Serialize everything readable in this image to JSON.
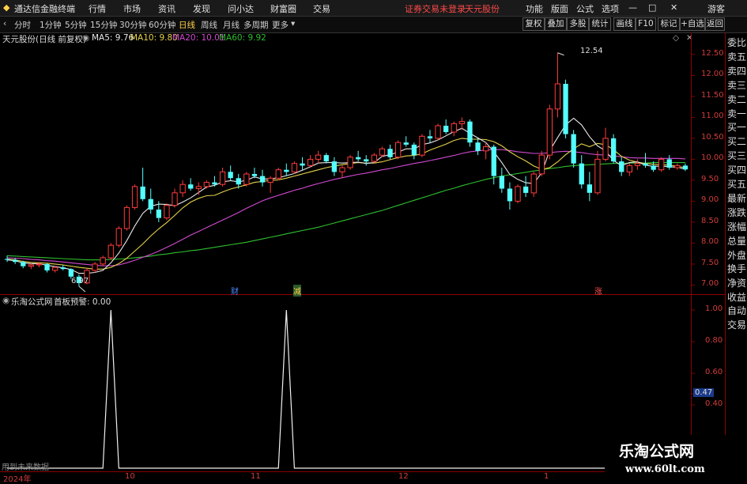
{
  "menubar": {
    "app_title": "通达信金融终端",
    "menus": [
      "行情",
      "市场",
      "资讯",
      "发现",
      "问小达",
      "财富圈",
      "交易"
    ],
    "status": "证券交易未登录",
    "stock_name": "天元股份",
    "right_menus": [
      "功能",
      "版面",
      "公式",
      "选项"
    ],
    "guest": "游客"
  },
  "toolbar": {
    "periods": [
      "分时",
      "1分钟",
      "5分钟",
      "15分钟",
      "30分钟",
      "60分钟",
      "日线",
      "周线",
      "月线",
      "多周期",
      "更多"
    ],
    "active_period": "日线",
    "buttons": [
      "复权",
      "叠加",
      "多股",
      "统计",
      "画线",
      "F10",
      "标记",
      "+自选",
      "返回"
    ]
  },
  "chart_header": {
    "stock_label": "天元股份(日线 前复权)",
    "ma5": "MA5: 9.76",
    "ma10": "MA10: 9.80",
    "ma20": "MA20: 10.01",
    "ma60": "MA60: 9.92"
  },
  "colors": {
    "up": "#ff3b3b",
    "down": "#54ffff",
    "ma5": "#e8e8e8",
    "ma10": "#e6d34a",
    "ma20": "#d24ad2",
    "ma60": "#2fbf2f",
    "axis": "#d23c3c"
  },
  "price_axis": [
    "12.50",
    "12.00",
    "11.50",
    "11.00",
    "10.50",
    "10.00",
    "9.50",
    "9.00",
    "8.50",
    "8.00",
    "7.50",
    "7.00"
  ],
  "annotations": {
    "high": "12.54",
    "low": "6.97",
    "markers": [
      "财",
      "减",
      "涨"
    ]
  },
  "side_panel": [
    "委比",
    "卖五",
    "卖四",
    "卖三",
    "卖二",
    "卖一",
    "买一",
    "买二",
    "买三",
    "买四",
    "买五",
    "最新",
    "涨跌",
    "涨幅",
    "总量",
    "外盘",
    "换手",
    "净资",
    "收益",
    "自动",
    "交易"
  ],
  "indicator": {
    "name": "乐淘公式网",
    "title": "首板预警: 0.00",
    "axis": [
      "1.00",
      "0.80",
      "0.60",
      "0.47",
      "0.40"
    ],
    "footer": "用到未来数据"
  },
  "x_axis": [
    "2024年",
    "10",
    "11",
    "12",
    "1"
  ],
  "watermark": {
    "title": "乐淘公式网",
    "url": "www.60lt.com"
  },
  "chart_data": {
    "type": "candlestick",
    "candles": [
      [
        7.62,
        7.7,
        7.55,
        7.6
      ],
      [
        7.6,
        7.65,
        7.5,
        7.55
      ],
      [
        7.55,
        7.58,
        7.4,
        7.45
      ],
      [
        7.45,
        7.52,
        7.38,
        7.48
      ],
      [
        7.48,
        7.55,
        7.42,
        7.5
      ],
      [
        7.5,
        7.52,
        7.3,
        7.35
      ],
      [
        7.35,
        7.45,
        7.3,
        7.42
      ],
      [
        7.42,
        7.48,
        7.35,
        7.38
      ],
      [
        7.38,
        7.4,
        7.15,
        7.2
      ],
      [
        7.2,
        7.25,
        6.97,
        7.05
      ],
      [
        7.05,
        7.4,
        7.02,
        7.35
      ],
      [
        7.35,
        7.55,
        7.3,
        7.5
      ],
      [
        7.5,
        7.7,
        7.45,
        7.65
      ],
      [
        7.65,
        8.0,
        7.6,
        7.95
      ],
      [
        7.95,
        8.4,
        7.9,
        8.35
      ],
      [
        8.35,
        8.9,
        8.3,
        8.85
      ],
      [
        8.85,
        9.4,
        8.8,
        9.35
      ],
      [
        9.35,
        9.8,
        9.0,
        9.05
      ],
      [
        9.05,
        9.3,
        8.7,
        8.8
      ],
      [
        8.8,
        9.0,
        8.5,
        8.6
      ],
      [
        8.6,
        8.95,
        8.55,
        8.9
      ],
      [
        8.9,
        9.3,
        8.85,
        9.2
      ],
      [
        9.2,
        9.5,
        9.1,
        9.4
      ],
      [
        9.4,
        9.55,
        9.25,
        9.3
      ],
      [
        9.3,
        9.45,
        9.15,
        9.35
      ],
      [
        9.35,
        9.5,
        9.3,
        9.45
      ],
      [
        9.45,
        9.6,
        9.35,
        9.4
      ],
      [
        9.4,
        9.8,
        9.35,
        9.7
      ],
      [
        9.7,
        9.85,
        9.5,
        9.55
      ],
      [
        9.55,
        9.65,
        9.3,
        9.4
      ],
      [
        9.4,
        9.7,
        9.35,
        9.65
      ],
      [
        9.65,
        9.8,
        9.55,
        9.6
      ],
      [
        9.6,
        9.75,
        9.35,
        9.45
      ],
      [
        9.45,
        9.6,
        9.2,
        9.55
      ],
      [
        9.55,
        9.8,
        9.5,
        9.75
      ],
      [
        9.75,
        9.9,
        9.6,
        9.7
      ],
      [
        9.7,
        9.95,
        9.65,
        9.9
      ],
      [
        9.9,
        10.05,
        9.75,
        9.85
      ],
      [
        9.85,
        10.1,
        9.8,
        10.0
      ],
      [
        10.0,
        10.2,
        9.9,
        10.1
      ],
      [
        10.1,
        10.15,
        9.9,
        9.95
      ],
      [
        9.95,
        10.05,
        9.6,
        9.7
      ],
      [
        9.7,
        9.85,
        9.55,
        9.8
      ],
      [
        9.8,
        10.1,
        9.75,
        10.05
      ],
      [
        10.05,
        10.2,
        9.95,
        10.0
      ],
      [
        10.0,
        10.1,
        9.85,
        9.95
      ],
      [
        9.95,
        10.15,
        9.9,
        10.1
      ],
      [
        10.1,
        10.3,
        10.05,
        10.25
      ],
      [
        10.25,
        10.35,
        10.0,
        10.05
      ],
      [
        10.05,
        10.45,
        10.0,
        10.4
      ],
      [
        10.4,
        10.55,
        10.3,
        10.35
      ],
      [
        10.35,
        10.4,
        10.0,
        10.1
      ],
      [
        10.1,
        10.6,
        10.05,
        10.55
      ],
      [
        10.55,
        10.7,
        10.4,
        10.5
      ],
      [
        10.5,
        10.85,
        10.45,
        10.8
      ],
      [
        10.8,
        10.95,
        10.6,
        10.65
      ],
      [
        10.65,
        10.9,
        10.55,
        10.85
      ],
      [
        10.85,
        11.0,
        10.7,
        10.9
      ],
      [
        10.9,
        10.95,
        10.3,
        10.4
      ],
      [
        10.4,
        10.5,
        10.1,
        10.2
      ],
      [
        10.2,
        10.4,
        10.0,
        10.3
      ],
      [
        10.3,
        10.35,
        9.4,
        9.6
      ],
      [
        9.6,
        9.8,
        9.2,
        9.3
      ],
      [
        9.3,
        9.45,
        8.8,
        9.0
      ],
      [
        9.0,
        9.4,
        8.95,
        9.35
      ],
      [
        9.35,
        9.6,
        9.1,
        9.2
      ],
      [
        9.2,
        9.7,
        9.1,
        9.65
      ],
      [
        9.65,
        10.2,
        9.6,
        10.1
      ],
      [
        10.1,
        11.3,
        10.0,
        11.2
      ],
      [
        11.2,
        12.54,
        11.0,
        11.8
      ],
      [
        11.8,
        11.9,
        10.5,
        10.6
      ],
      [
        10.6,
        10.7,
        9.8,
        9.9
      ],
      [
        9.9,
        10.1,
        9.3,
        9.4
      ],
      [
        9.4,
        9.7,
        9.0,
        9.2
      ],
      [
        9.2,
        10.2,
        9.15,
        10.0
      ],
      [
        10.0,
        10.75,
        9.95,
        10.5
      ],
      [
        10.5,
        10.6,
        9.9,
        9.95
      ],
      [
        9.95,
        10.05,
        9.6,
        9.7
      ],
      [
        9.7,
        9.9,
        9.6,
        9.85
      ],
      [
        9.85,
        10.0,
        9.75,
        9.9
      ],
      [
        9.9,
        10.15,
        9.8,
        9.85
      ],
      [
        9.85,
        9.95,
        9.7,
        9.75
      ],
      [
        9.75,
        10.05,
        9.7,
        10.0
      ],
      [
        10.0,
        10.1,
        9.75,
        9.8
      ],
      [
        9.8,
        9.9,
        9.75,
        9.85
      ],
      [
        9.85,
        9.9,
        9.72,
        9.76
      ]
    ],
    "ma5": [
      7.6,
      7.58,
      7.53,
      7.51,
      7.51,
      7.47,
      7.44,
      7.41,
      7.37,
      7.28,
      7.28,
      7.3,
      7.35,
      7.53,
      7.76,
      8.06,
      8.41,
      8.71,
      8.88,
      8.93,
      8.92,
      8.89,
      8.98,
      9.08,
      9.21,
      9.34,
      9.38,
      9.46,
      9.49,
      9.46,
      9.5,
      9.58,
      9.53,
      9.53,
      9.56,
      9.61,
      9.66,
      9.74,
      9.82,
      9.91,
      9.92,
      9.92,
      9.91,
      9.92,
      9.93,
      9.9,
      9.92,
      10.07,
      10.11,
      10.17,
      10.25,
      10.25,
      10.35,
      10.39,
      10.46,
      10.56,
      10.66,
      10.74,
      10.62,
      10.51,
      10.4,
      10.18,
      9.92,
      9.64,
      9.52,
      9.44,
      9.42,
      9.68,
      10.21,
      10.52,
      10.82,
      10.98,
      10.82,
      10.54,
      10.32,
      10.2,
      9.97,
      9.85,
      9.92,
      9.94,
      9.86,
      9.83,
      9.84,
      9.82,
      9.81,
      9.76
    ],
    "ma10": [
      7.62,
      7.6,
      7.56,
      7.54,
      7.53,
      7.52,
      7.5,
      7.48,
      7.45,
      7.42,
      7.4,
      7.38,
      7.38,
      7.42,
      7.51,
      7.64,
      7.81,
      7.98,
      8.17,
      8.34,
      8.49,
      8.66,
      8.84,
      8.98,
      9.07,
      9.13,
      9.14,
      9.22,
      9.29,
      9.34,
      9.39,
      9.45,
      9.47,
      9.5,
      9.51,
      9.55,
      9.6,
      9.65,
      9.7,
      9.75,
      9.8,
      9.84,
      9.87,
      9.9,
      9.92,
      9.91,
      9.91,
      9.94,
      9.99,
      10.04,
      10.08,
      10.09,
      10.13,
      10.22,
      10.29,
      10.36,
      10.45,
      10.5,
      10.48,
      10.48,
      10.47,
      10.42,
      10.32,
      10.18,
      10.06,
      9.96,
      9.84,
      9.76,
      9.8,
      9.94,
      10.11,
      10.25,
      10.37,
      10.3,
      10.38,
      10.35,
      10.23,
      10.07,
      9.98,
      9.93,
      9.9,
      9.88,
      9.87,
      9.86,
      9.83,
      9.8
    ],
    "ma20": [
      7.65,
      7.64,
      7.63,
      7.61,
      7.6,
      7.58,
      7.57,
      7.55,
      7.53,
      7.51,
      7.49,
      7.47,
      7.46,
      7.46,
      7.48,
      7.53,
      7.59,
      7.66,
      7.73,
      7.81,
      7.9,
      7.99,
      8.09,
      8.19,
      8.28,
      8.37,
      8.46,
      8.55,
      8.64,
      8.73,
      8.83,
      8.92,
      9.01,
      9.08,
      9.14,
      9.2,
      9.26,
      9.31,
      9.37,
      9.42,
      9.47,
      9.52,
      9.56,
      9.6,
      9.64,
      9.67,
      9.71,
      9.75,
      9.78,
      9.82,
      9.86,
      9.9,
      9.93,
      9.97,
      10.01,
      10.05,
      10.09,
      10.14,
      10.18,
      10.2,
      10.22,
      10.23,
      10.23,
      10.21,
      10.18,
      10.16,
      10.14,
      10.14,
      10.16,
      10.18,
      10.19,
      10.18,
      10.16,
      10.13,
      10.11,
      10.1,
      10.08,
      10.06,
      10.04,
      10.03,
      10.03,
      10.02,
      10.02,
      10.02,
      10.02,
      10.01
    ],
    "ma60": [
      7.7,
      7.69,
      7.68,
      7.67,
      7.66,
      7.65,
      7.64,
      7.63,
      7.62,
      7.61,
      7.6,
      7.6,
      7.6,
      7.61,
      7.62,
      7.63,
      7.65,
      7.67,
      7.69,
      7.72,
      7.74,
      7.77,
      7.79,
      7.82,
      7.84,
      7.87,
      7.9,
      7.93,
      7.96,
      7.99,
      8.02,
      8.06,
      8.1,
      8.14,
      8.18,
      8.22,
      8.26,
      8.3,
      8.34,
      8.38,
      8.43,
      8.48,
      8.53,
      8.58,
      8.63,
      8.68,
      8.73,
      8.78,
      8.84,
      8.9,
      8.96,
      9.02,
      9.08,
      9.14,
      9.2,
      9.26,
      9.31,
      9.37,
      9.42,
      9.47,
      9.52,
      9.56,
      9.6,
      9.63,
      9.66,
      9.69,
      9.72,
      9.75,
      9.78,
      9.8,
      9.83,
      9.85,
      9.86,
      9.87,
      9.88,
      9.89,
      9.9,
      9.9,
      9.91,
      9.91,
      9.91,
      9.92,
      9.92,
      9.92,
      9.92,
      9.92
    ],
    "signal_spikes": [
      13,
      35
    ],
    "ylim": [
      6.8,
      12.8
    ]
  }
}
